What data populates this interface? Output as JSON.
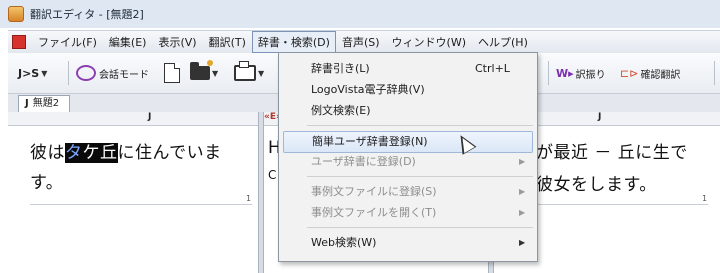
{
  "window": {
    "title": "翻訳エディタ - [無題2]"
  },
  "menubar": {
    "items": [
      "ファイル(F)",
      "編集(E)",
      "表示(V)",
      "翻訳(T)",
      "辞書・検索(D)",
      "音声(S)",
      "ウィンドウ(W)",
      "ヘルプ(H)"
    ],
    "active_index": 4
  },
  "toolbar": {
    "direction": "J>S",
    "conversation_mode": "会話モード",
    "retranslate": "訳振り",
    "confirm_translate": "確認翻訳"
  },
  "tab": {
    "prefix": "J",
    "label": "無題2"
  },
  "panes": {
    "left": {
      "ruler_label": "J",
      "line1_before": "彼は",
      "line1_sel_a": "タ",
      "line1_sel_b": "ケ丘",
      "line1_after": "に住んでいま",
      "line2": "す。",
      "para_num": "1"
    },
    "middle": {
      "ruler_marker": "«E»",
      "line1": "H",
      "line2": "C"
    },
    "right": {
      "ruler_label": "J",
      "line1": "が最近 － 丘に生で",
      "line2": "彼女をします。",
      "para_num": "1"
    }
  },
  "dropdown": {
    "items": [
      {
        "label": "辞書引き(L)",
        "shortcut": "Ctrl+L",
        "disabled": false,
        "submenu": false
      },
      {
        "label": "LogoVista電子辞典(V)",
        "shortcut": "",
        "disabled": false,
        "submenu": false
      },
      {
        "label": "例文検索(E)",
        "shortcut": "",
        "disabled": false,
        "submenu": false
      },
      {
        "label": "簡単ユーザ辞書登録(N)",
        "shortcut": "",
        "disabled": false,
        "submenu": false,
        "hover": true
      },
      {
        "label": "ユーザ辞書に登録(D)",
        "shortcut": "",
        "disabled": true,
        "submenu": true
      },
      {
        "label": "事例文ファイルに登録(S)",
        "shortcut": "",
        "disabled": true,
        "submenu": true
      },
      {
        "label": "事例文ファイルを開く(T)",
        "shortcut": "",
        "disabled": true,
        "submenu": true
      },
      {
        "label": "Web検索(W)",
        "shortcut": "",
        "disabled": false,
        "submenu": true
      }
    ]
  }
}
